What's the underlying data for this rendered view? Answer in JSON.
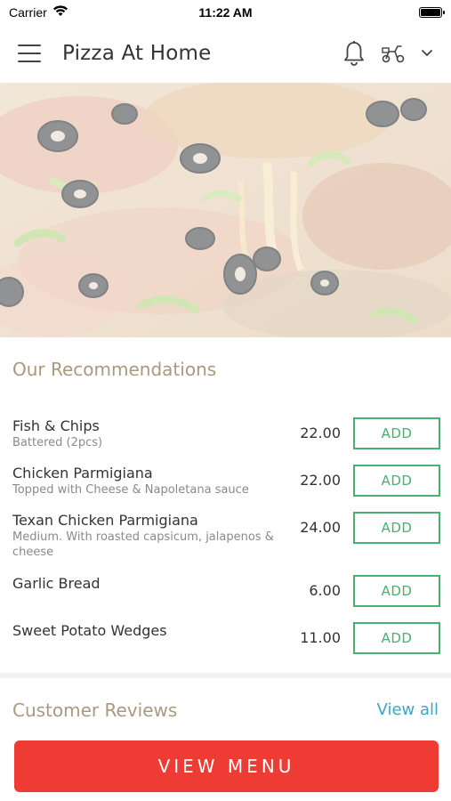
{
  "status_bar": {
    "carrier": "Carrier",
    "time": "11:22 AM"
  },
  "header": {
    "title": "Pizza At Home",
    "menu_icon": "hamburger-menu-icon",
    "notification_icon": "bell-icon",
    "delivery_icon": "scooter-icon",
    "dropdown_icon": "chevron-down-icon"
  },
  "hero": {
    "image": "pizza-photo"
  },
  "recommendations": {
    "title": "Our Recommendations",
    "items": [
      {
        "name": "Fish & Chips",
        "description": "Battered (2pcs)",
        "price": "22.00",
        "button": "ADD"
      },
      {
        "name": "Chicken Parmigiana",
        "description": "Topped with Cheese & Napoletana sauce",
        "price": "22.00",
        "button": "ADD"
      },
      {
        "name": "Texan Chicken Parmigiana",
        "description": "Medium. With roasted capsicum, jalapenos & cheese",
        "price": "24.00",
        "button": "ADD"
      },
      {
        "name": "Garlic Bread",
        "description": "",
        "price": "6.00",
        "button": "ADD"
      },
      {
        "name": "Sweet Potato Wedges",
        "description": "",
        "price": "11.00",
        "button": "ADD"
      }
    ]
  },
  "reviews": {
    "title": "Customer Reviews",
    "view_all": "View all"
  },
  "cta": {
    "label": "VIEW MENU"
  },
  "colors": {
    "accent_green": "#4caf72",
    "section_title": "#a89a7e",
    "link_blue": "#3aa6c8",
    "cta_red": "#ee3b34"
  }
}
